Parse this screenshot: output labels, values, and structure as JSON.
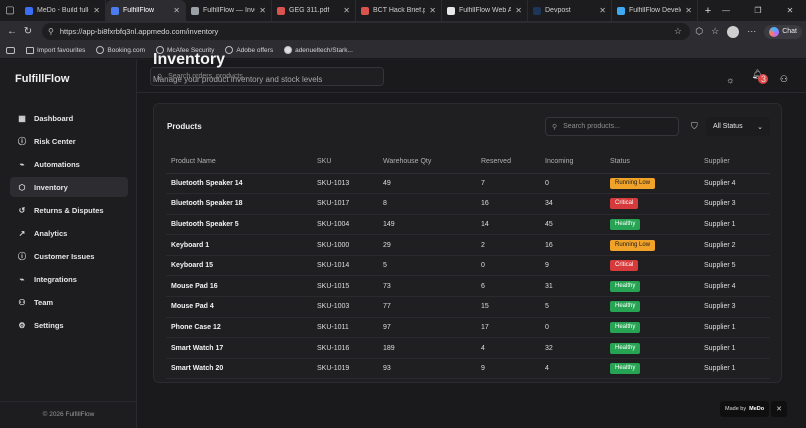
{
  "browser": {
    "tabs": [
      {
        "label": "MeDo - Build full-s",
        "color": "#3b6ef5",
        "active": false
      },
      {
        "label": "FulfillFlow",
        "color": "#4a7cf0",
        "active": true
      },
      {
        "label": "FulfillFlow — Inven",
        "color": "#9aa0a6",
        "active": false
      },
      {
        "label": "GEG 311.pdf",
        "color": "#d9534f",
        "active": false
      },
      {
        "label": "BCT Hack Brief.pdf",
        "color": "#d9534f",
        "active": false
      },
      {
        "label": "FulfillFlow Web App",
        "color": "#e8e8e8",
        "active": false
      },
      {
        "label": "Devpost",
        "color": "#1d3557",
        "active": false
      },
      {
        "label": "FulfillFlow Develop",
        "color": "#3fa9f5",
        "active": false
      }
    ],
    "new_tab": "+",
    "url": "https://app-bi8fxrbfq3nl.appmedo.com/inventory",
    "chat_label": "Chat",
    "bookmarks": [
      "Import favourites",
      "Booking.com",
      "McAfee Security",
      "Adobe offers",
      "adenueltech/Stark..."
    ]
  },
  "sidebar": {
    "brand": "FulfillFlow",
    "items": [
      {
        "label": "Dashboard",
        "icon": "▦",
        "active": false
      },
      {
        "label": "Risk Center",
        "icon": "ⓘ",
        "active": false
      },
      {
        "label": "Automations",
        "icon": "⌁",
        "active": false
      },
      {
        "label": "Inventory",
        "icon": "⬡",
        "active": true
      },
      {
        "label": "Returns & Disputes",
        "icon": "↺",
        "active": false
      },
      {
        "label": "Analytics",
        "icon": "↗",
        "active": false
      },
      {
        "label": "Customer Issues",
        "icon": "ⓘ",
        "active": false
      },
      {
        "label": "Integrations",
        "icon": "⌁",
        "active": false
      },
      {
        "label": "Team",
        "icon": "⚇",
        "active": false
      },
      {
        "label": "Settings",
        "icon": "⚙",
        "active": false
      }
    ],
    "copyright": "© 2026 FulfillFlow"
  },
  "header": {
    "search_placeholder": "Search orders, products...",
    "notification_count": "3"
  },
  "page": {
    "title": "Inventory",
    "subtitle": "Manage your product inventory and stock levels"
  },
  "products": {
    "title": "Products",
    "search_placeholder": "Search products...",
    "status_filter": "All Status",
    "columns": [
      "Product Name",
      "SKU",
      "Warehouse Qty",
      "Reserved",
      "Incoming",
      "Status",
      "Supplier"
    ],
    "rows": [
      {
        "name": "Bluetooth Speaker 14",
        "sku": "SKU-1013",
        "qty": "49",
        "reserved": "7",
        "incoming": "0",
        "status": "Running Low",
        "status_kind": "running-low",
        "supplier": "Supplier 4"
      },
      {
        "name": "Bluetooth Speaker 18",
        "sku": "SKU-1017",
        "qty": "8",
        "reserved": "16",
        "incoming": "34",
        "status": "Critical",
        "status_kind": "critical",
        "supplier": "Supplier 3"
      },
      {
        "name": "Bluetooth Speaker 5",
        "sku": "SKU-1004",
        "qty": "149",
        "reserved": "14",
        "incoming": "45",
        "status": "Healthy",
        "status_kind": "healthy",
        "supplier": "Supplier 1"
      },
      {
        "name": "Keyboard 1",
        "sku": "SKU-1000",
        "qty": "29",
        "reserved": "2",
        "incoming": "16",
        "status": "Running Low",
        "status_kind": "running-low",
        "supplier": "Supplier 2"
      },
      {
        "name": "Keyboard 15",
        "sku": "SKU-1014",
        "qty": "5",
        "reserved": "0",
        "incoming": "9",
        "status": "Critical",
        "status_kind": "critical",
        "supplier": "Supplier 5"
      },
      {
        "name": "Mouse Pad 16",
        "sku": "SKU-1015",
        "qty": "73",
        "reserved": "6",
        "incoming": "31",
        "status": "Healthy",
        "status_kind": "healthy",
        "supplier": "Supplier 4"
      },
      {
        "name": "Mouse Pad 4",
        "sku": "SKU-1003",
        "qty": "77",
        "reserved": "15",
        "incoming": "5",
        "status": "Healthy",
        "status_kind": "healthy",
        "supplier": "Supplier 3"
      },
      {
        "name": "Phone Case 12",
        "sku": "SKU-1011",
        "qty": "97",
        "reserved": "17",
        "incoming": "0",
        "status": "Healthy",
        "status_kind": "healthy",
        "supplier": "Supplier 1"
      },
      {
        "name": "Smart Watch 17",
        "sku": "SKU-1016",
        "qty": "189",
        "reserved": "4",
        "incoming": "32",
        "status": "Healthy",
        "status_kind": "healthy",
        "supplier": "Supplier 1"
      },
      {
        "name": "Smart Watch 20",
        "sku": "SKU-1019",
        "qty": "93",
        "reserved": "9",
        "incoming": "4",
        "status": "Healthy",
        "status_kind": "healthy",
        "supplier": "Supplier 1"
      }
    ]
  },
  "made_by": {
    "prefix": "Made by",
    "brand": "MeDo",
    "close": "✕"
  },
  "colors": {
    "running_low": "#f0a229",
    "critical": "#d63a3a",
    "healthy": "#27a453"
  }
}
